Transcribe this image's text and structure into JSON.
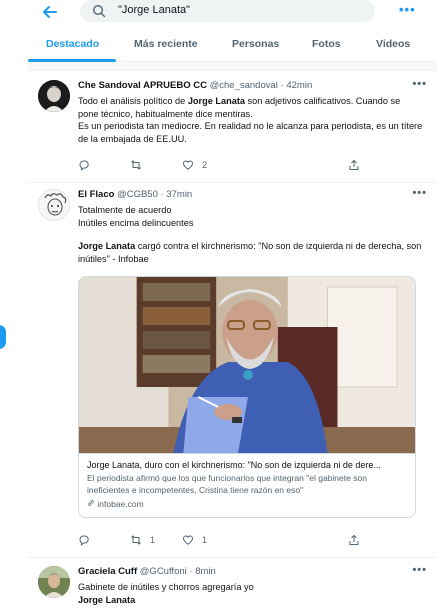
{
  "search": {
    "query": "\"Jorge Lanata\""
  },
  "tabs": [
    {
      "label": "Destacado"
    },
    {
      "label": "Más reciente"
    },
    {
      "label": "Personas"
    },
    {
      "label": "Fotos"
    },
    {
      "label": "Videos"
    }
  ],
  "tweets": [
    {
      "name": "Che Sandoval APRUEBO CC",
      "handle": "@che_sandoval",
      "time": "· 42min",
      "text_pre": "Todo el análisis político de ",
      "text_bold": "Jorge Lanata",
      "text_post": " son adjetivos calificativos. Cuando se pone técnico, habitualmente dice mentiras.",
      "text_line2": "Es un periodista tan mediocre. En realidad no le alcanza para periodista, es un títere de la embajada de EE.UU.",
      "replies": "",
      "retweets": "",
      "likes": "2"
    },
    {
      "name": "El Flaco",
      "handle": "@CGB50",
      "time": "· 37min",
      "line1": "Totalmente de acuerdo",
      "line2": "Inútiles encima delincuentes",
      "quote_bold": "Jorge Lanata",
      "quote_rest": " cargó contra el kirchnerismo: \"No son de izquierda ni de derecha, son inútiles\" - Infobae",
      "card_title": "Jorge Lanata, duro con el kirchnerismo: \"No son de izquierda ni de dere...",
      "card_desc": "El periodista afirmó que los que funcionarios que integran \"el gabinete son ineficientes e incompetentes, Cristina tiene razón en eso\"",
      "card_domain": "infobae.com",
      "replies": "",
      "retweets": "1",
      "likes": "1"
    },
    {
      "name": "Graciela Cuff",
      "handle": "@GCuffoni",
      "time": "· 8min",
      "line1": "Gabinete de inútiles y  chorros agregaría yo",
      "line2_bold": "Jorge Lanata"
    }
  ],
  "colors": {
    "accent": "#1d9bf0",
    "text": "#0f1419",
    "muted": "#536471",
    "border": "#eff3f4"
  },
  "icons": {
    "back": "arrow-left-icon",
    "search": "search-icon",
    "more": "more-icon",
    "reply": "reply-icon",
    "retweet": "retweet-icon",
    "like": "heart-icon",
    "share": "share-icon",
    "link": "link-icon"
  }
}
